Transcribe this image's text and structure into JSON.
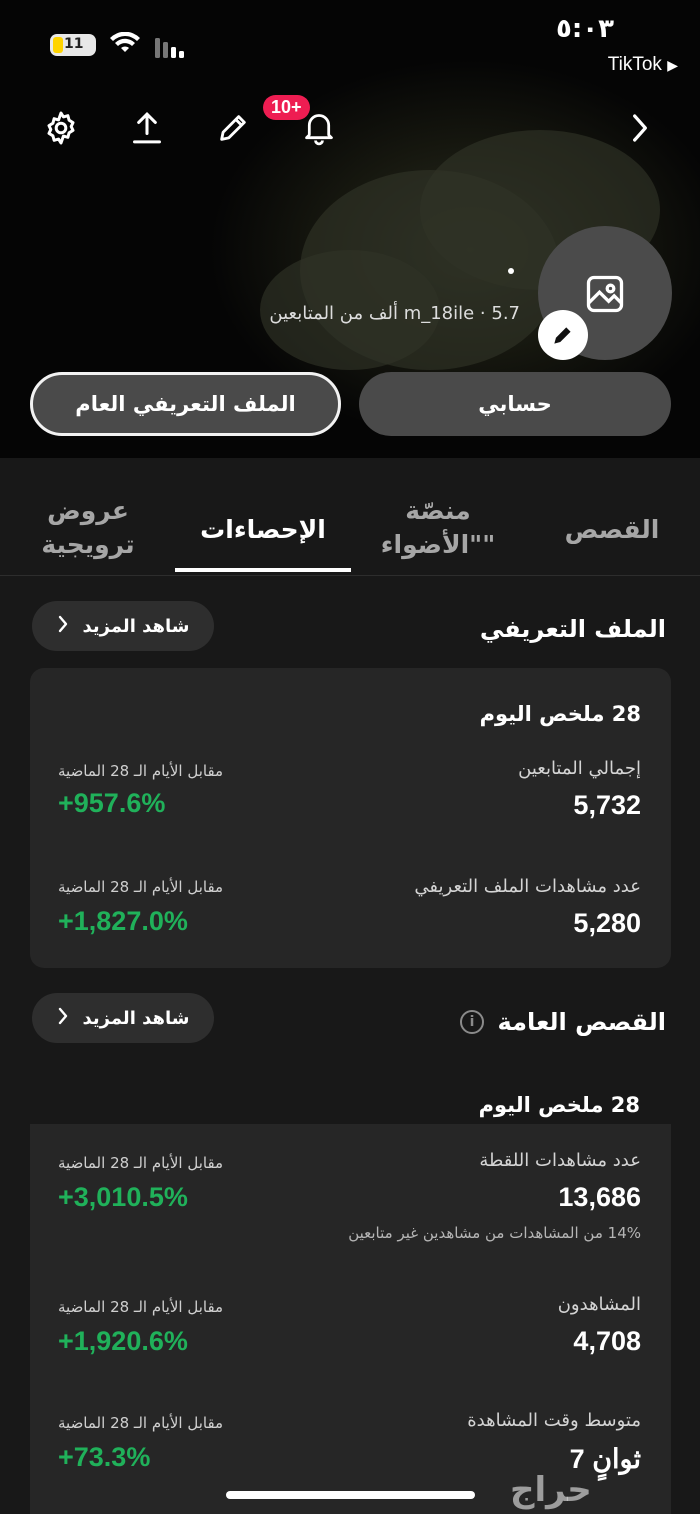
{
  "status": {
    "time": "٥:٠٣",
    "battery": "11",
    "back_app": "TikTok"
  },
  "header": {
    "notification_badge": "10+"
  },
  "profile": {
    "meta": "m_18ile · 5.7 ألف من المتابعين",
    "btn_account": "حسابي",
    "btn_public": "الملف التعريفي العام"
  },
  "tabs": [
    {
      "label": "القصص"
    },
    {
      "label": "منصّة \"الأضواء\""
    },
    {
      "label": "الإحصاءات"
    },
    {
      "label": "عروض ترويجية"
    }
  ],
  "profile_section": {
    "title": "الملف التعريفي",
    "more": "شاهد المزيد",
    "summary": "28 ملخص اليوم",
    "metrics": [
      {
        "label": "إجمالي المتابعين",
        "value": "5,732",
        "cmp_label": "مقابل الأيام الـ 28 الماضية",
        "cmp_value": "+957.6%"
      },
      {
        "label": "عدد مشاهدات الملف التعريفي",
        "value": "5,280",
        "cmp_label": "مقابل الأيام الـ 28 الماضية",
        "cmp_value": "+1,827.0%"
      }
    ]
  },
  "stories_section": {
    "title": "القصص العامة",
    "more": "شاهد المزيد",
    "summary": "28 ملخص اليوم",
    "metrics": [
      {
        "label": "عدد مشاهدات اللقطة",
        "value": "13,686",
        "note": "14% من المشاهدات من مشاهدين غير متابعين",
        "cmp_label": "مقابل الأيام الـ 28 الماضية",
        "cmp_value": "+3,010.5%"
      },
      {
        "label": "المشاهدون",
        "value": "4,708",
        "cmp_label": "مقابل الأيام الـ 28 الماضية",
        "cmp_value": "+1,920.6%"
      },
      {
        "label": "متوسط وقت المشاهدة",
        "value": "7 ثوانٍ",
        "cmp_label": "مقابل الأيام الـ 28 الماضية",
        "cmp_value": "+73.3%"
      }
    ]
  },
  "watermark": "حراج",
  "colors": {
    "accent_green": "#20b15a",
    "badge_red": "#ee1d52",
    "background": "#181818",
    "card": "#262626"
  }
}
